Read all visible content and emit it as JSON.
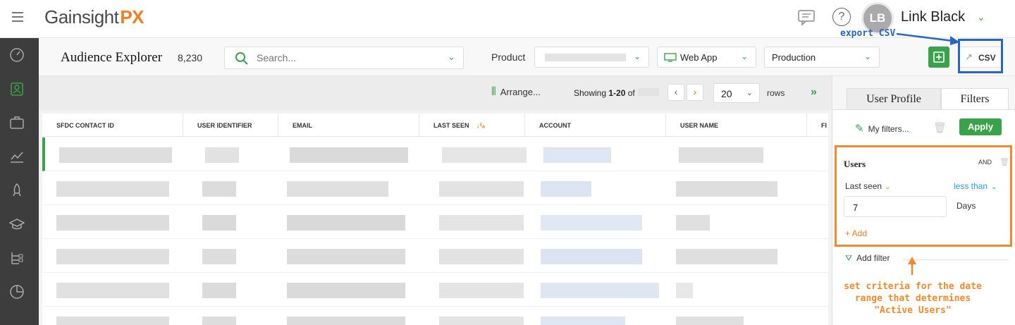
{
  "app": {
    "logo_main": "Gainsight",
    "logo_px": "PX",
    "user_name": "Link Black",
    "user_initials": "LB",
    "help_glyph": "?"
  },
  "header": {
    "title": "Audience Explorer",
    "count": "8,230",
    "search_placeholder": "Search...",
    "product_label": "Product",
    "channel": "Web App",
    "environment": "Production",
    "csv_label": "CSV"
  },
  "toolbar": {
    "arrange_label": "Arrange...",
    "showing_prefix": "Showing ",
    "showing_range": "1-20",
    "showing_of": " of ",
    "rows_value": "20",
    "rows_label": "rows"
  },
  "table": {
    "columns": [
      "SFDC CONTACT ID",
      "USER IDENTIFIER",
      "EMAIL",
      "LAST SEEN",
      "ACCOUNT",
      "USER NAME",
      "FI"
    ]
  },
  "panel": {
    "tab_profile": "User Profile",
    "tab_filters": "Filters",
    "my_filters": "My filters...",
    "apply": "Apply",
    "group_title": "Users",
    "group_op": "AND",
    "field": "Last seen",
    "operator": "less than",
    "value": "7",
    "unit": "Days",
    "add": "+ Add",
    "add_filter": "Add filter"
  },
  "annotations": {
    "export": "export CSV",
    "criteria": "set criteria for the date range that determines \"Active Users\""
  },
  "colors": {
    "brand_green": "#3aa24a",
    "brand_orange": "#f57c20",
    "annotation_blue": "#2a64c5",
    "annotation_orange": "#f08a2c",
    "nav_bg": "#3d3d3d"
  },
  "icons": {
    "menu": "hamburger-icon",
    "chat": "chat-icon",
    "help": "help-icon",
    "search": "search-icon",
    "add": "add-user-icon",
    "export": "external-link-icon",
    "arrange": "columns-icon",
    "filter": "funnel-icon"
  }
}
